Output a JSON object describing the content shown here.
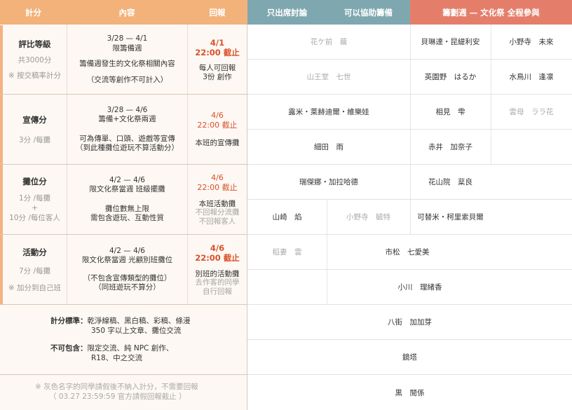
{
  "headers": {
    "score": "計分",
    "content": "內容",
    "reply": "回報",
    "attend": "只出席討論",
    "assist": "可以協助籌備",
    "full": "籌劃週 — 文化祭 全程參與"
  },
  "categories": [
    {
      "name": "評比等級",
      "sub1": "共3000分",
      "sub2": "※ 按交稿率計分",
      "content_lines": [
        "3/28 — 4/1",
        "限籌備週",
        "",
        "籌備週發生的文化祭相關內容",
        "",
        "（交流等創作不可計入）"
      ],
      "deadline_date": "4/1",
      "deadline_time": "22:00 截止",
      "reply_lines": [
        "每人可回報",
        "3份 創作"
      ],
      "reply_grey_lines": []
    },
    {
      "name": "宣傳分",
      "sub1": "3分 /每攤",
      "sub2": "",
      "content_lines": [
        "3/28 — 4/6",
        "籌備+文化祭兩週",
        "",
        "可為傳單、口頭、遊戲等宣傳",
        "（到此種攤位遊玩不算活動分）"
      ],
      "deadline_date": "4/6",
      "deadline_time": "22:00 截止",
      "reply_lines": [
        "本班的宣傳攤"
      ],
      "reply_grey_lines": []
    },
    {
      "name": "攤位分",
      "sub1": "1分 /每攤",
      "sub2": "+",
      "sub3": "10分 /每位客人",
      "content_lines": [
        "4/2 — 4/6",
        "限文化祭當週 班級擺攤",
        "",
        "攤位數無上限",
        "需包含遊玩、互動性質"
      ],
      "deadline_date": "4/6",
      "deadline_time": "22:00 截止",
      "reply_lines": [
        "本班活動攤"
      ],
      "reply_grey_lines": [
        "不回報分流攤",
        "不回報客人"
      ]
    },
    {
      "name": "活動分",
      "sub1": "7分 /每攤",
      "sub2": "※ 加分到自己班",
      "content_lines": [
        "4/2 — 4/6",
        "限文化祭當週 光顧別班攤位",
        "",
        "（不包含宣傳類型的攤位）",
        "（同班遊玩不算分）"
      ],
      "deadline_date": "4/6",
      "deadline_time": "22:00 截止",
      "reply_lines": [
        "別班的活動攤"
      ],
      "reply_grey_lines": [
        "去作客的同學",
        "自行回報"
      ]
    }
  ],
  "rules": {
    "standard_label": "計分標準：",
    "standard_text1": "乾淨線稿、黑白稿、彩稿、條漫",
    "standard_text2": "350 字以上文章、攤位交流",
    "exclude_label": "不可包含：",
    "exclude_text1": "限定交流、純 NPC 創作、",
    "exclude_text2": "R18、中之交流"
  },
  "footnote": {
    "line1": "※ 灰色名字的同學請假後不納入計分，不需要回報",
    "line2": "（ 03.27  23:59:59  官方請假回報截止 ）"
  },
  "names": {
    "r1_attend": "花ケ前　繭",
    "r1_full_a": "貝琳達・昆緹利安",
    "r1_full_b": "小野寺　未來",
    "r2_attend": "山王堂　七世",
    "r2_full_a": "英園野　はるか",
    "r2_full_b": "水鳥川　逢凛",
    "r3_attend": "露米・萊赫迪爾・維樂娃",
    "r3_full_a": "相見　雫",
    "r3_full_b": "雲母　ララ花",
    "r4_attend": "細田　雨",
    "r4_full_a": "赤井　加奈子",
    "r5_attend": "瑞傑娜・加拉哈德",
    "r5_full_a": "花山院　棻良",
    "r6_attend_a": "山崎　焰",
    "r6_attend_b": "小野寺　毓特",
    "r6_full_a": "可替米・柯里索貝爾",
    "r7_attend_a": "稻妻　雲",
    "r7_assist": "市松　七愛美",
    "r8_assist": "小川　理緒香",
    "r9_assist": "八街　加加芽",
    "r10_assist": "鏡塔",
    "r11_assist": "黒　閒係"
  }
}
